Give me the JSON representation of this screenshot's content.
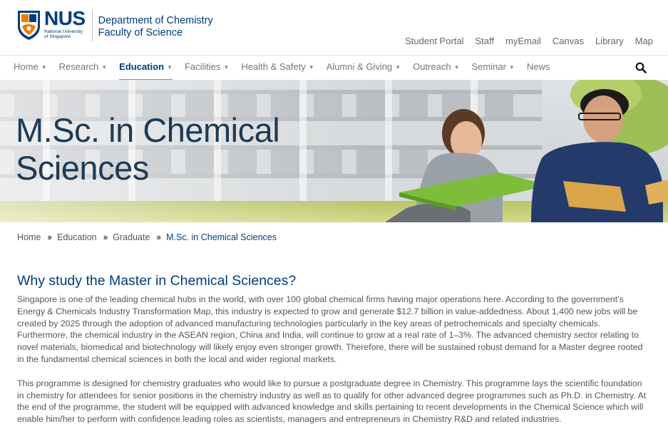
{
  "brand": {
    "logo_word": "NUS",
    "logo_sub_line1": "National University",
    "logo_sub_line2": "of Singapore",
    "dept_line1": "Department of Chemistry",
    "dept_line2": "Faculty of Science",
    "colors": {
      "primary": "#003d7c",
      "accent": "#ef7c00"
    }
  },
  "utility_links": [
    "Student Portal",
    "Staff",
    "myEmail",
    "Canvas",
    "Library",
    "Map"
  ],
  "nav": {
    "items": [
      {
        "label": "Home",
        "caret": true
      },
      {
        "label": "Research",
        "caret": true
      },
      {
        "label": "Education",
        "caret": true,
        "active": true
      },
      {
        "label": "Facilities",
        "caret": true
      },
      {
        "label": "Health & Safety",
        "caret": true
      },
      {
        "label": "Alumni & Giving",
        "caret": true
      },
      {
        "label": "Outreach",
        "caret": true
      },
      {
        "label": "Seminar",
        "caret": true
      },
      {
        "label": "News",
        "caret": false
      }
    ],
    "search_icon": "search-icon"
  },
  "banner": {
    "title_line1": "M.Sc. in Chemical",
    "title_line2": "Sciences"
  },
  "breadcrumb": [
    "Home",
    "Education",
    "Graduate",
    "M.Sc. in Chemical Sciences"
  ],
  "main": {
    "heading": "Why study the Master in Chemical Sciences?",
    "paragraphs": [
      "Singapore is one of the leading chemical hubs in the world, with over 100 global chemical firms having major operations here. According to the government’s Energy & Chemicals Industry Transformation Map, this industry is expected to grow and generate $12.7 billion in value-addedness. About 1,400 new jobs will be created by 2025 through the adoption of advanced manufacturing technologies particularly in the key areas of petrochemicals and specialty chemicals. Furthermore, the chemical industry in the ASEAN region, China and India, will continue to grow at a real rate of 1–3%. The advanced chemistry sector relating to novel materials, biomedical and biotechnology will likely enjoy even stronger growth. Therefore, there will be sustained robust demand for a Master degree rooted in the fundamental chemical sciences in both the local and wider regional markets.",
      "This programme is designed for chemistry graduates who would like to pursue a postgraduate degree in Chemistry. This programme lays the scientific foundation in chemistry for attendees for senior positions in the chemistry industry as well as to qualify for other advanced degree programmes such as Ph.D. in Chemistry. At the end of the programme, the student will be equipped with advanced knowledge and skills pertaining to recent developments in the Chemical Science which will enable him/her to perform with confidence leading roles as scientists, managers and entrepreneurs in Chemistry R&D and related industries."
    ]
  }
}
